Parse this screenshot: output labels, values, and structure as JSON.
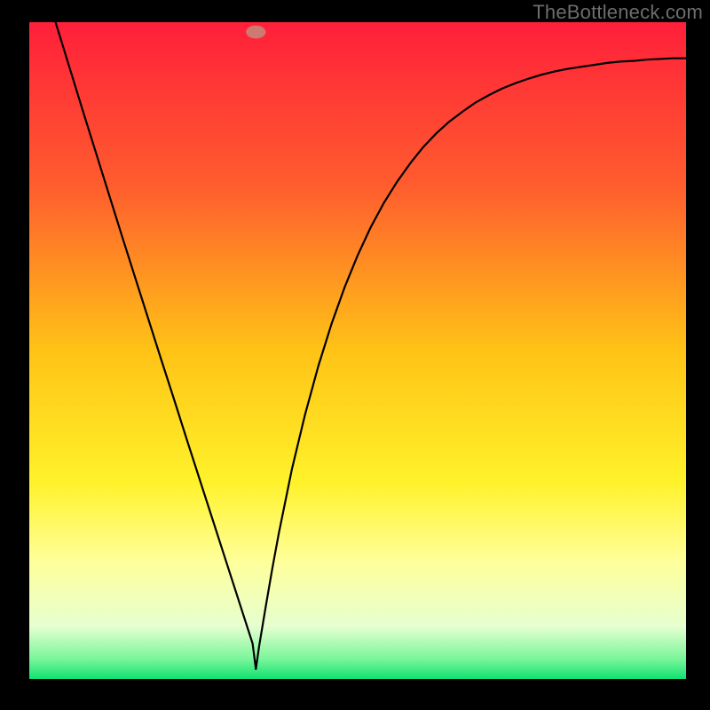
{
  "watermark": "TheBottleneck.com",
  "chart_data": {
    "type": "line",
    "title": "",
    "xlabel": "",
    "ylabel": "",
    "xlim": [
      0,
      1
    ],
    "ylim": [
      0,
      1
    ],
    "background": {
      "type": "vertical-gradient",
      "stops": [
        {
          "offset": 0.0,
          "color": "#ff1f3a"
        },
        {
          "offset": 0.25,
          "color": "#ff5d2e"
        },
        {
          "offset": 0.5,
          "color": "#ffc316"
        },
        {
          "offset": 0.7,
          "color": "#fff22a"
        },
        {
          "offset": 0.82,
          "color": "#ffff9a"
        },
        {
          "offset": 0.92,
          "color": "#e6ffd0"
        },
        {
          "offset": 0.97,
          "color": "#79f59a"
        },
        {
          "offset": 1.0,
          "color": "#10e270"
        }
      ]
    },
    "marker": {
      "x": 0.345,
      "y": 0.985,
      "color": "#cc7a72",
      "rx": 0.015,
      "ry": 0.01
    },
    "series": [
      {
        "name": "curve",
        "color": "#000000",
        "stroke_width": 2.2,
        "x": [
          0.04,
          0.06,
          0.08,
          0.1,
          0.12,
          0.14,
          0.16,
          0.18,
          0.2,
          0.22,
          0.24,
          0.26,
          0.28,
          0.3,
          0.31,
          0.32,
          0.33,
          0.34,
          0.345,
          0.35,
          0.36,
          0.37,
          0.38,
          0.4,
          0.42,
          0.44,
          0.46,
          0.48,
          0.5,
          0.52,
          0.54,
          0.56,
          0.58,
          0.6,
          0.62,
          0.64,
          0.66,
          0.68,
          0.7,
          0.72,
          0.74,
          0.76,
          0.78,
          0.8,
          0.82,
          0.84,
          0.86,
          0.88,
          0.9,
          0.92,
          0.94,
          0.96,
          0.98,
          1.0
        ],
        "y": [
          1.0,
          0.935,
          0.87,
          0.806,
          0.742,
          0.678,
          0.615,
          0.552,
          0.489,
          0.427,
          0.364,
          0.302,
          0.24,
          0.178,
          0.147,
          0.116,
          0.085,
          0.054,
          0.015,
          0.05,
          0.11,
          0.168,
          0.222,
          0.32,
          0.403,
          0.476,
          0.54,
          0.596,
          0.645,
          0.688,
          0.725,
          0.757,
          0.785,
          0.81,
          0.831,
          0.849,
          0.864,
          0.878,
          0.889,
          0.899,
          0.907,
          0.914,
          0.92,
          0.925,
          0.929,
          0.932,
          0.935,
          0.938,
          0.94,
          0.941,
          0.943,
          0.944,
          0.945,
          0.945
        ]
      }
    ]
  }
}
